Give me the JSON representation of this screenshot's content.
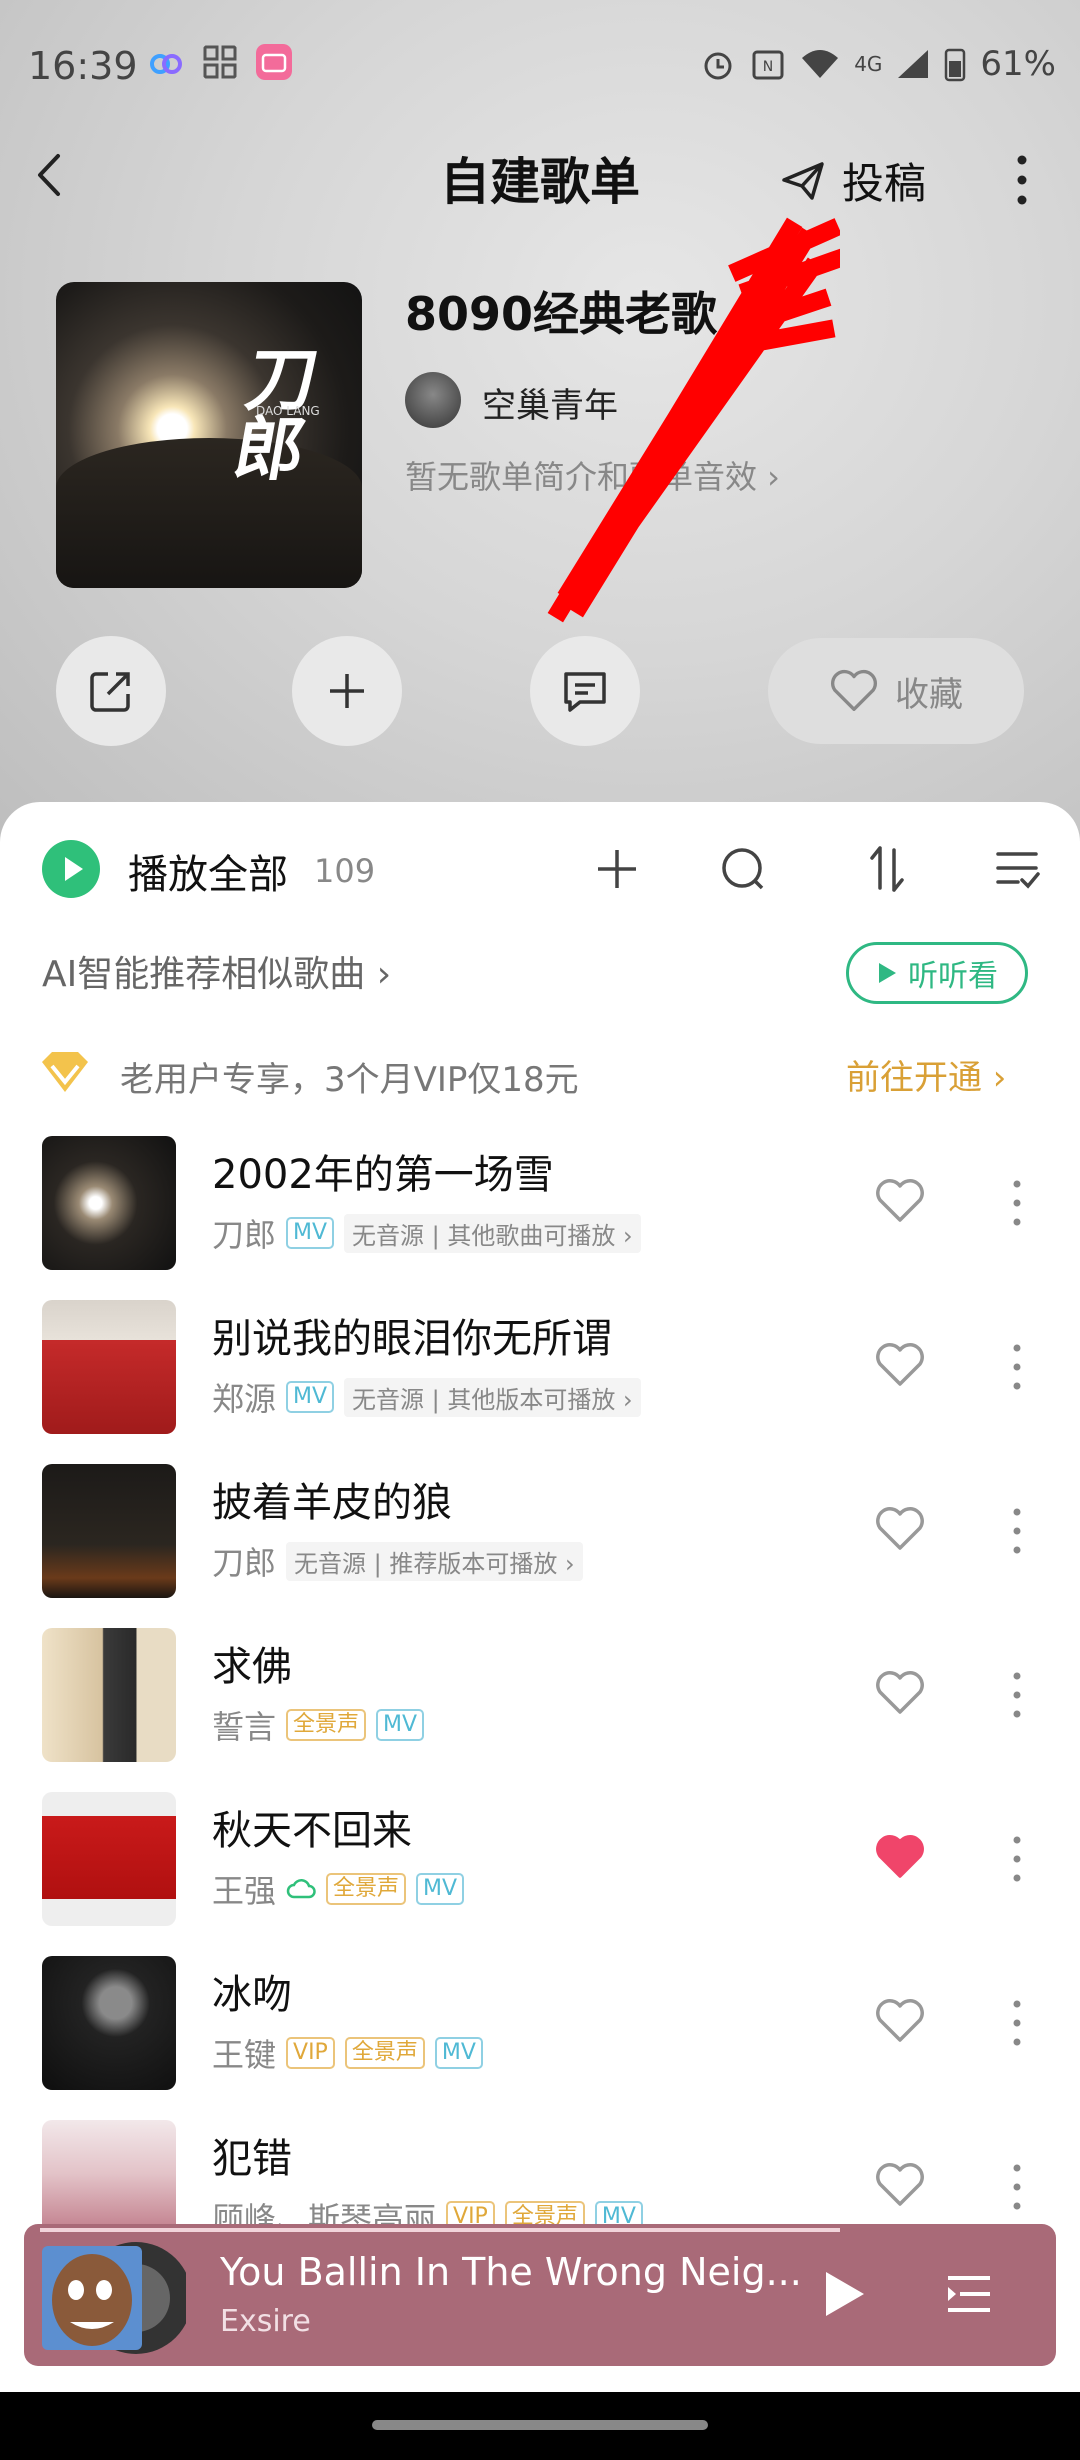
{
  "status_bar": {
    "time": "16:39",
    "battery": "61%",
    "network": "4G"
  },
  "header": {
    "title": "自建歌单",
    "submit_label": "投稿"
  },
  "playlist": {
    "name": "8090经典老歌",
    "creator": "空巢青年",
    "description_link": "暂无歌单简介和歌单音效 ›",
    "cover_text": "刀郎",
    "cover_subtext": "DAO LANG"
  },
  "actions": {
    "favorite_label": "收藏"
  },
  "list_header": {
    "play_all_label": "播放全部",
    "count": "109"
  },
  "ai_recommend": {
    "label": "AI智能推荐相似歌曲 ›",
    "listen_label": "听听看"
  },
  "vip_banner": {
    "text": "老用户专享，3个月VIP仅18元",
    "cta": "前往开通 ›"
  },
  "songs": [
    {
      "title": "2002年的第一场雪",
      "artist": "刀郎",
      "tags": [
        "MV"
      ],
      "note": "无音源 | 其他歌曲可播放 ›",
      "liked": false
    },
    {
      "title": "别说我的眼泪你无所谓",
      "artist": "郑源",
      "tags": [
        "MV"
      ],
      "note": "无音源 | 其他版本可播放 ›",
      "liked": false
    },
    {
      "title": "披着羊皮的狼",
      "artist": "刀郎",
      "tags": [],
      "note": "无音源 | 推荐版本可播放 ›",
      "liked": false
    },
    {
      "title": "求佛",
      "artist": "誓言",
      "tags": [
        "全景声",
        "MV"
      ],
      "note": "",
      "liked": false
    },
    {
      "title": "秋天不回来",
      "artist": "王强",
      "tags": [
        "全景声",
        "MV"
      ],
      "note": "",
      "liked": true
    },
    {
      "title": "冰吻",
      "artist": "王键",
      "tags": [
        "VIP",
        "全景声",
        "MV"
      ],
      "note": "",
      "liked": false
    },
    {
      "title": "犯错",
      "artist": "顾峰、斯琴高丽",
      "tags": [
        "VIP",
        "全景声",
        "MV"
      ],
      "note": "",
      "liked": false
    }
  ],
  "player": {
    "title": "You Ballin In The Wrong Neig...",
    "artist": "Exsire"
  },
  "colors": {
    "accent": "#2fc07a",
    "vip_gold": "#d9a036",
    "like_red": "#f0456a",
    "player_bg": "#a96a78"
  }
}
